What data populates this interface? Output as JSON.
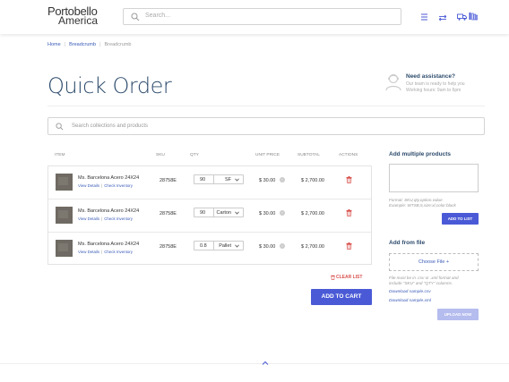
{
  "header": {
    "logo_line1": "Portobello",
    "logo_line2": "America",
    "search_placeholder": "Search..."
  },
  "breadcrumb": [
    "Home",
    "Breadcrumb",
    "Breadcrumb"
  ],
  "page_title": "Quick Order",
  "assistance": {
    "title": "Need assistance?",
    "line1": "Our team is ready to help you",
    "line2": "Working hours: 9am to 6pm"
  },
  "collections_search_placeholder": "Search collections and products",
  "table": {
    "headers": {
      "item": "ITEM",
      "sku": "SKU",
      "qty": "QTY",
      "unit_price": "UNIT PRICE",
      "subtotal": "SUBTOTAL",
      "actions": "ACTIONS"
    },
    "rows": [
      {
        "name": "Ms. Barcelona Acero 24X24",
        "view": "View Details",
        "check": "Check Inventory",
        "sku": "28758E",
        "qty": "90",
        "unit": "SF",
        "price": "$ 30.00",
        "subtotal": "$ 2,700.00"
      },
      {
        "name": "Ms. Barcelona Acero 24X24",
        "view": "View Details",
        "check": "Check Inventory",
        "sku": "28758E",
        "qty": "90",
        "unit": "Carton",
        "price": "$ 30.00",
        "subtotal": "$ 2,700.00"
      },
      {
        "name": "Ms. Barcelona Acero 24X24",
        "view": "View Details",
        "check": "Check Inventory",
        "sku": "28758E",
        "qty": "0.8",
        "unit": "Pallet",
        "price": "$ 30.00",
        "subtotal": "$ 2,700.00"
      }
    ]
  },
  "clear_list": "CLEAR LIST",
  "add_to_cart": "ADD TO CART",
  "add_multiple": {
    "title": "Add multiple products",
    "hint1": "Format: SKU,qty,option.value",
    "hint2": "Example: WTSB,5,size:xl,color:black",
    "button": "ADD TO LIST"
  },
  "add_from_file": {
    "title": "Add from file",
    "choose": "Choose File +",
    "hint1": "File must be in .csv or .xml format and",
    "hint2": "include \"SKU\" and \"QTY\" columns.",
    "csv": "Download sample.csv",
    "xml": "Download sample.xml",
    "button": "UPLOAD NOW"
  },
  "colors": {
    "primary": "#4a5ad6",
    "title": "#2c4a6b",
    "link": "#3a5bb8",
    "danger": "#d9534f"
  }
}
